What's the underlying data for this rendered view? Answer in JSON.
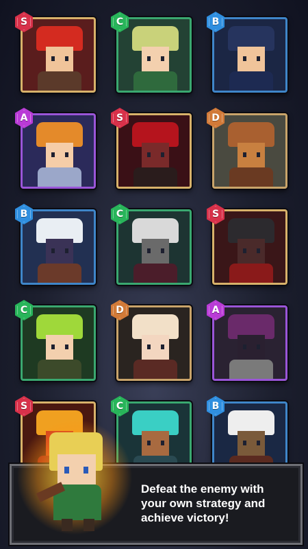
{
  "characters": [
    {
      "rank": "S",
      "hair": "#d42b20",
      "skin": "#f0c49a",
      "outfit": "#5b3a2a",
      "bg": "#5a1d1d"
    },
    {
      "rank": "C",
      "hair": "#c9d27a",
      "skin": "#f3d0ae",
      "outfit": "#2f6a3d",
      "bg": "#234234"
    },
    {
      "rank": "B",
      "hair": "#26345e",
      "skin": "#f0c49a",
      "outfit": "#1d2a52",
      "bg": "#1b2644"
    },
    {
      "rank": "A",
      "hair": "#e48a2a",
      "skin": "#f5cda8",
      "outfit": "#9ba7c9",
      "bg": "#2b2a5a"
    },
    {
      "rank": "S",
      "hair": "#b5141d",
      "skin": "#7a2a2a",
      "outfit": "#2a1c1c",
      "bg": "#3a1016"
    },
    {
      "rank": "D",
      "hair": "#a96030",
      "skin": "#c88040",
      "outfit": "#6a3a22",
      "bg": "#4a4a40"
    },
    {
      "rank": "B",
      "hair": "#e9eef3",
      "skin": "#3a3256",
      "outfit": "#6b3a2a",
      "bg": "#223052"
    },
    {
      "rank": "C",
      "hair": "#d9d9d9",
      "skin": "#6a6a6a",
      "outfit": "#4b1d2a",
      "bg": "#1d3432"
    },
    {
      "rank": "S",
      "hair": "#2c2a2e",
      "skin": "#4a2a2a",
      "outfit": "#8a1a1a",
      "bg": "#3a1618"
    },
    {
      "rank": "C",
      "hair": "#9fd83a",
      "skin": "#f3d0ae",
      "outfit": "#3c4a2a",
      "bg": "#1e3a22"
    },
    {
      "rank": "D",
      "hair": "#f2e0c8",
      "skin": "#f3d6c0",
      "outfit": "#5a2a24",
      "bg": "#2a2420"
    },
    {
      "rank": "A",
      "hair": "#6a2a6a",
      "skin": "#2a2030",
      "outfit": "#7a7a7a",
      "bg": "#2a2232"
    },
    {
      "rank": "S",
      "hair": "#f0a020",
      "skin": "#d44020",
      "outfit": "#a02018",
      "bg": "#4a1810"
    },
    {
      "rank": "C",
      "hair": "#3acfc4",
      "skin": "#a86a40",
      "outfit": "#2a4a52",
      "bg": "#1a3438"
    },
    {
      "rank": "B",
      "hair": "#eeeeee",
      "skin": "#7a5a3a",
      "outfit": "#5a2a20",
      "bg": "#1a2844"
    }
  ],
  "banner": {
    "text": "Defeat the enemy with your own strategy and achieve victory!"
  }
}
